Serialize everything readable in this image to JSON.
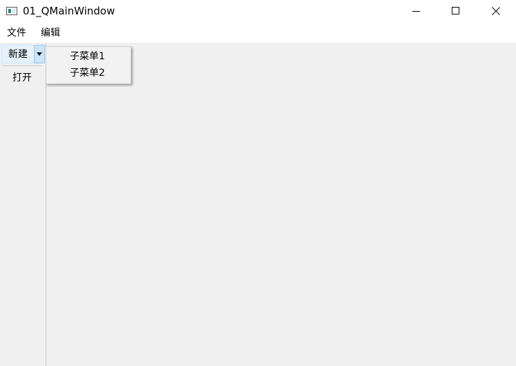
{
  "window": {
    "title": "01_QMainWindow",
    "icon": "qt-app-icon",
    "controls": {
      "minimize": "minimize-icon",
      "maximize": "maximize-icon",
      "close": "close-icon"
    }
  },
  "menubar": {
    "items": [
      {
        "label": "文件"
      },
      {
        "label": "编辑"
      }
    ]
  },
  "toolbar": {
    "new_label": "新建",
    "new_arrow_icon": "dropdown-arrow-icon",
    "open_label": "打开"
  },
  "dropdown": {
    "items": [
      {
        "label": "子菜单1"
      },
      {
        "label": "子菜单2"
      }
    ]
  },
  "colors": {
    "client_bg": "#f0f0f0",
    "hover_bg": "#e5f1fb",
    "pressed_bg": "#cce4f7",
    "titlebar_bg": "#ffffff"
  }
}
